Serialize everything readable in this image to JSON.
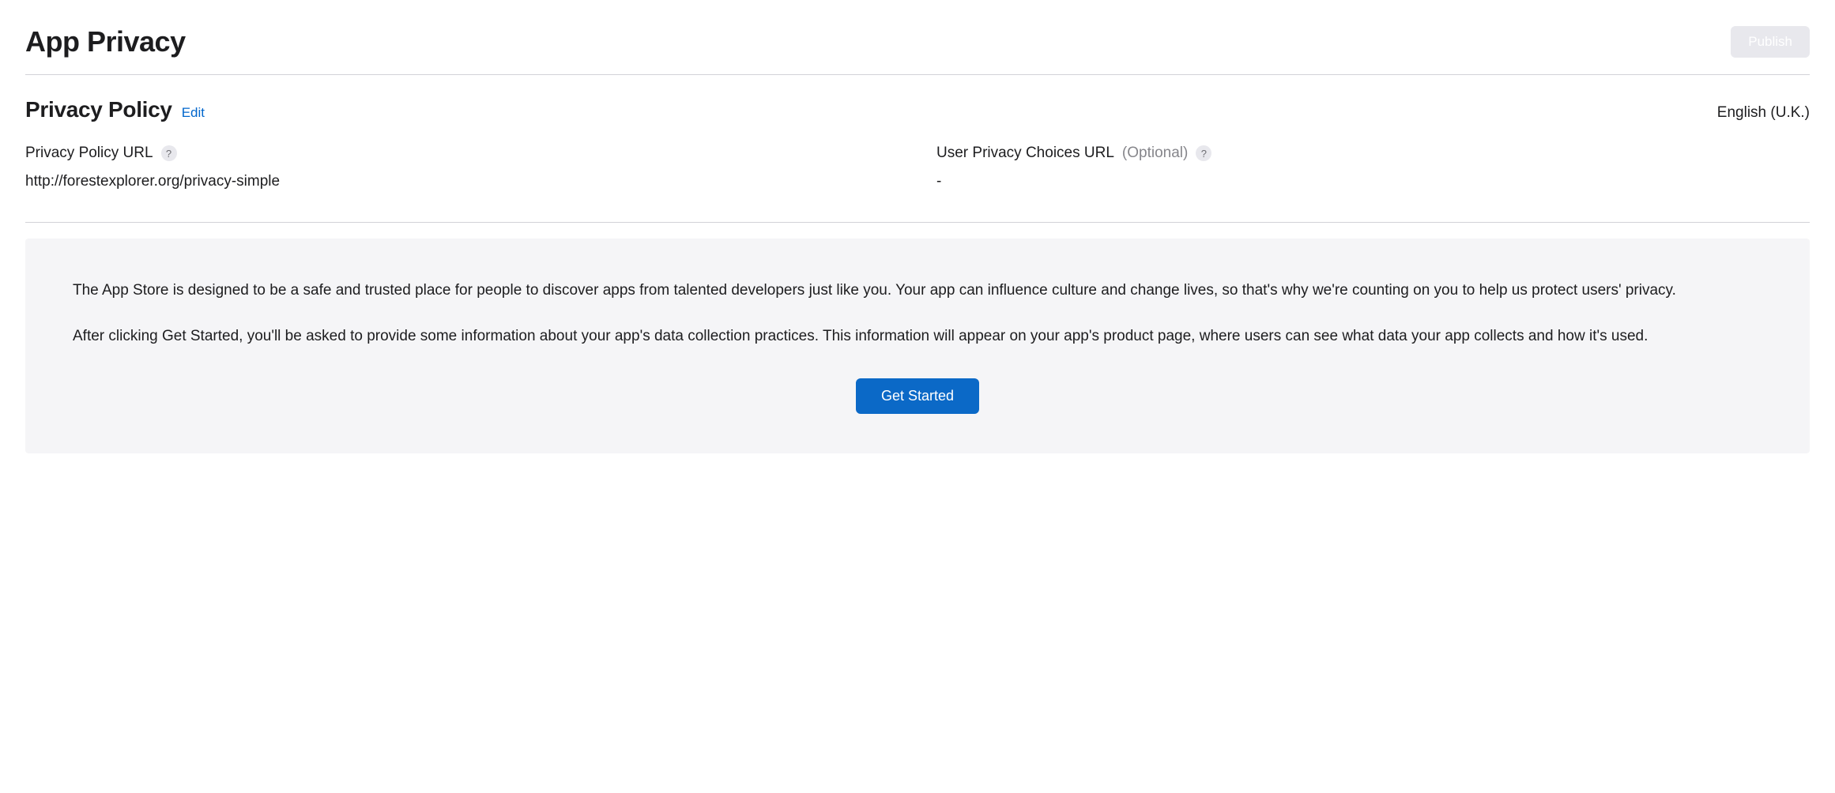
{
  "header": {
    "title": "App Privacy",
    "publish_label": "Publish"
  },
  "privacy_policy": {
    "section_title": "Privacy Policy",
    "edit_label": "Edit",
    "language": "English (U.K.)",
    "url_field": {
      "label": "Privacy Policy URL",
      "value": "http://forestexplorer.org/privacy-simple"
    },
    "choices_field": {
      "label": "User Privacy Choices URL",
      "optional": "(Optional)",
      "value": "-"
    }
  },
  "info": {
    "paragraph1": "The App Store is designed to be a safe and trusted place for people to discover apps from talented developers just like you. Your app can influence culture and change lives, so that's why we're counting on you to help us protect users' privacy.",
    "paragraph2": "After clicking Get Started, you'll be asked to provide some information about your app's data collection practices. This information will appear on your app's product page, where users can see what data your app collects and how it's used.",
    "cta_label": "Get Started"
  },
  "help_glyph": "?"
}
